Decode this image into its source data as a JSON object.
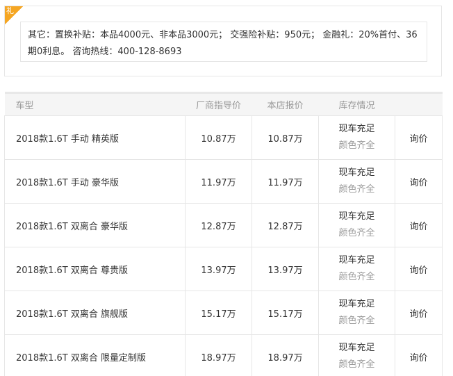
{
  "promo": {
    "badge": "礼",
    "text": "其它：置换补贴：本品4000元、非本品3000元； 交强险补贴：950元； 金融礼：20%首付、36期0利息。 咨询热线：400-128-8693"
  },
  "table": {
    "headers": {
      "model": "车型",
      "msrp": "厂商指导价",
      "dealer": "本店报价",
      "stock": "库存情况"
    },
    "rows": [
      {
        "model": "2018款1.6T 手动 精英版",
        "msrp": "10.87万",
        "dealer": "10.87万",
        "stock": "现车充足",
        "color": "颜色齐全",
        "action": "询价"
      },
      {
        "model": "2018款1.6T 手动 豪华版",
        "msrp": "11.97万",
        "dealer": "11.97万",
        "stock": "现车充足",
        "color": "颜色齐全",
        "action": "询价"
      },
      {
        "model": "2018款1.6T 双离合 豪华版",
        "msrp": "12.87万",
        "dealer": "12.87万",
        "stock": "现车充足",
        "color": "颜色齐全",
        "action": "询价"
      },
      {
        "model": "2018款1.6T 双离合 尊贵版",
        "msrp": "13.97万",
        "dealer": "13.97万",
        "stock": "现车充足",
        "color": "颜色齐全",
        "action": "询价"
      },
      {
        "model": "2018款1.6T 双离合 旗舰版",
        "msrp": "15.17万",
        "dealer": "15.17万",
        "stock": "现车充足",
        "color": "颜色齐全",
        "action": "询价"
      },
      {
        "model": "2018款1.6T 双离合 限量定制版",
        "msrp": "18.97万",
        "dealer": "18.97万",
        "stock": "现车充足",
        "color": "颜色齐全",
        "action": "询价"
      }
    ]
  },
  "colors": {
    "accent_badge": "#f5a623",
    "price_red": "#c3172a"
  }
}
